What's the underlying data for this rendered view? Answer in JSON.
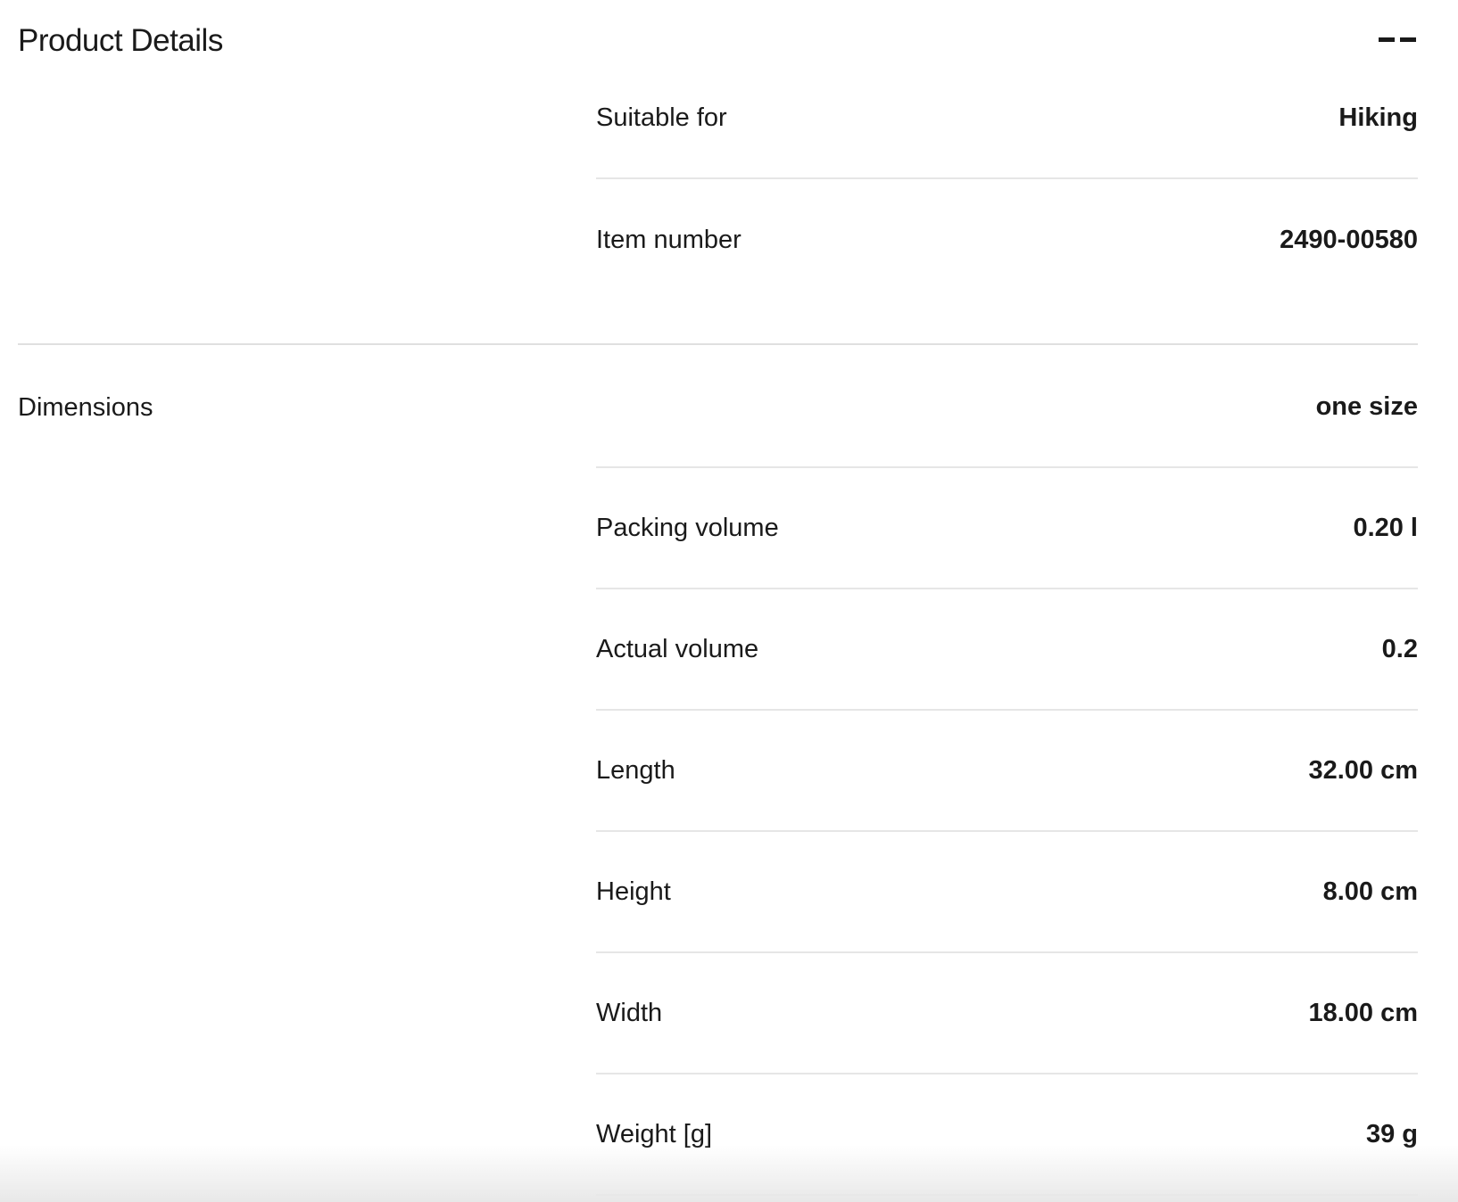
{
  "section": {
    "title": "Product Details"
  },
  "collapse_toggle": {
    "icon": "collapse-icon"
  },
  "general": {
    "rows": [
      {
        "label": "Suitable for",
        "value": "Hiking"
      },
      {
        "label": "Item number",
        "value": "2490-00580"
      }
    ]
  },
  "dimensions": {
    "label": "Dimensions",
    "rows": [
      {
        "label": "",
        "value": "one size"
      },
      {
        "label": "Packing volume",
        "value": "0.20 l"
      },
      {
        "label": "Actual volume",
        "value": "0.2"
      },
      {
        "label": "Length",
        "value": "32.00 cm"
      },
      {
        "label": "Height",
        "value": "8.00 cm"
      },
      {
        "label": "Width",
        "value": "18.00 cm"
      },
      {
        "label": "Weight [g]",
        "value": "39 g"
      }
    ]
  }
}
